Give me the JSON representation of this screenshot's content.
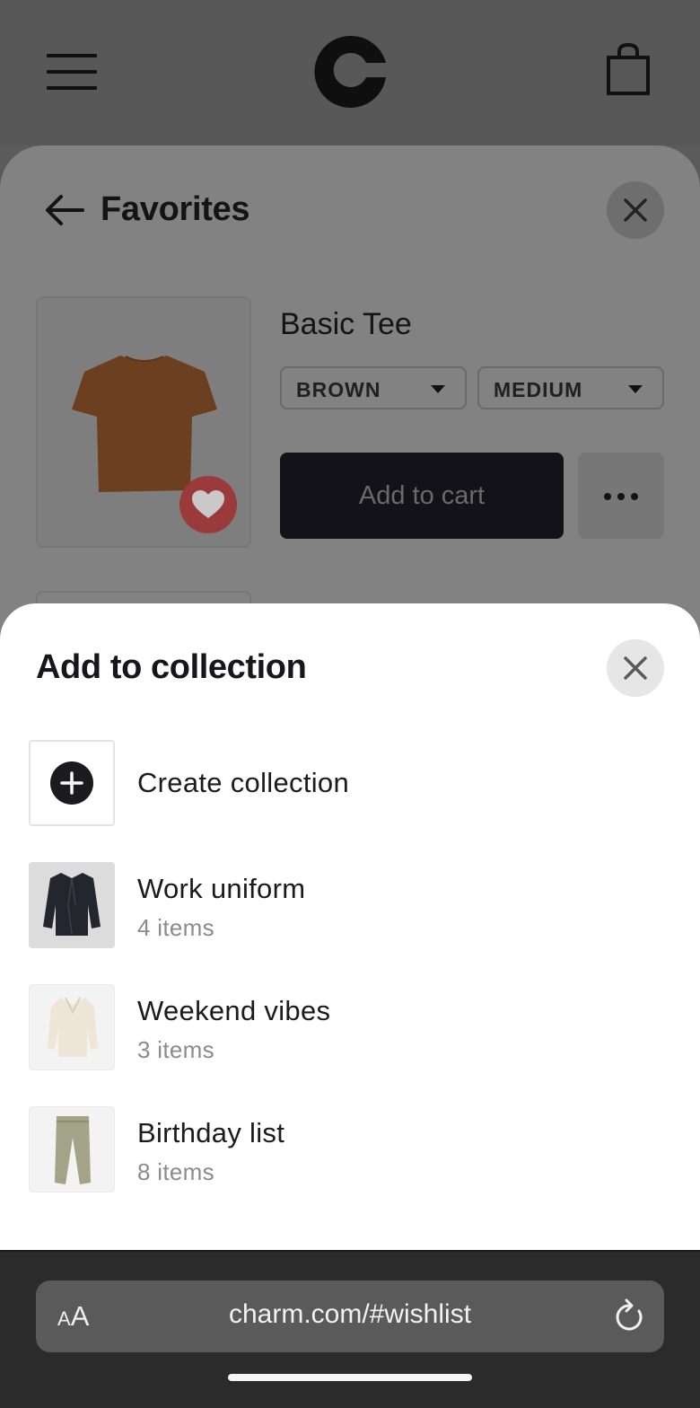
{
  "header": {
    "menu_icon": "hamburger-menu-icon",
    "logo_icon": "charm-logo-icon",
    "cart_icon": "shopping-bag-icon"
  },
  "favorites": {
    "title": "Favorites",
    "back_icon": "arrow-left-icon",
    "close_icon": "close-icon",
    "product": {
      "name": "Basic Tee",
      "color_option": "BROWN",
      "size_option": "MEDIUM",
      "add_to_cart_label": "Add to cart",
      "more_icon": "more-horizontal-icon",
      "favorite_icon": "heart-icon",
      "accent_color": "#9b3a3a"
    }
  },
  "sheet": {
    "title": "Add to collection",
    "close_icon": "close-icon",
    "create_label": "Create collection",
    "collections": [
      {
        "title": "Work uniform",
        "subtitle": "4 items"
      },
      {
        "title": "Weekend vibes",
        "subtitle": "3 items"
      },
      {
        "title": "Birthday list",
        "subtitle": "8 items"
      }
    ]
  },
  "browser": {
    "text_size_small": "A",
    "text_size_large": "A",
    "url": "charm.com/#wishlist",
    "reload_icon": "reload-icon"
  }
}
